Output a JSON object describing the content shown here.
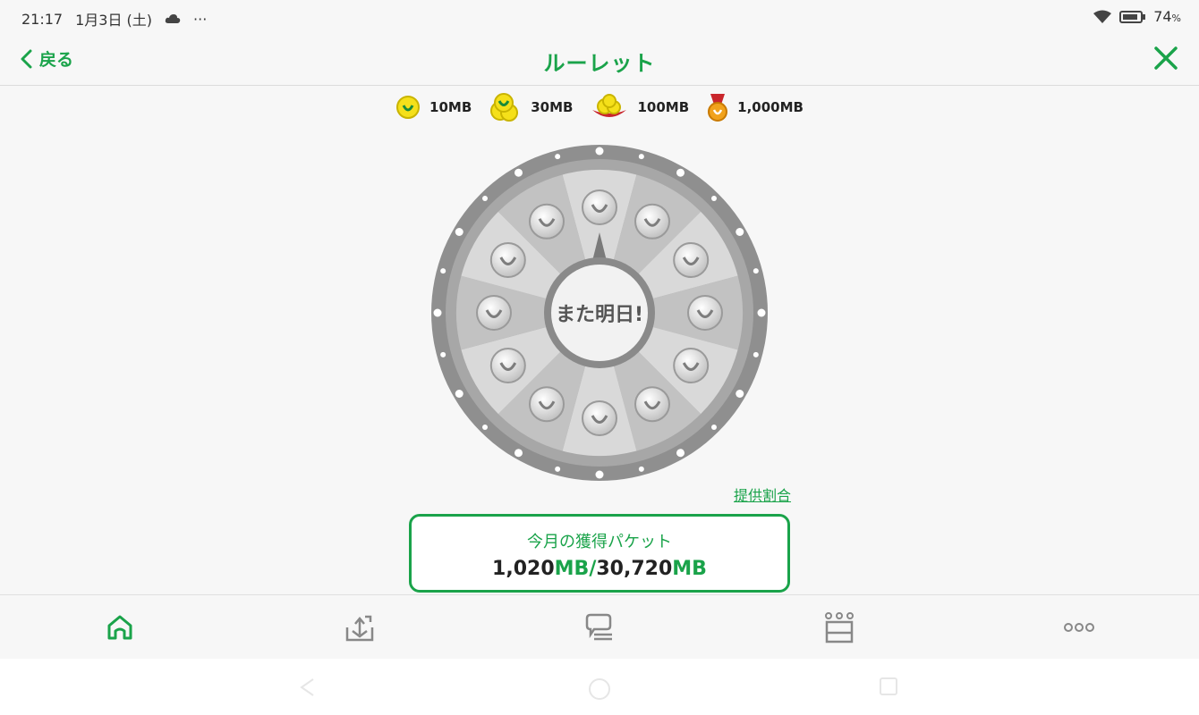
{
  "status": {
    "time": "21:17",
    "date": "1月3日 (土)",
    "more": "···",
    "battery": "74",
    "battery_unit": "%"
  },
  "header": {
    "back_label": "戻る",
    "title": "ルーレット"
  },
  "legend": [
    {
      "icon": "single-coin-icon",
      "label": "10MB"
    },
    {
      "icon": "coin-pile-icon",
      "label": "30MB"
    },
    {
      "icon": "coin-plate-icon",
      "label": "100MB"
    },
    {
      "icon": "gold-medal-icon",
      "label": "1,000MB"
    }
  ],
  "wheel": {
    "center_label": "また明日!"
  },
  "ratio_link": "提供割合",
  "packet": {
    "label": "今月の獲得パケット",
    "current": "1,020",
    "unit1": "MB",
    "slash": "/",
    "max": "30,720",
    "unit2": "MB"
  },
  "tabs": [
    "home-icon",
    "upload-tray-icon",
    "chat-icon",
    "ranking-crown-icon",
    "more-icon"
  ],
  "colors": {
    "accent": "#1aa34a",
    "wheel_dark": "#9a9a9a",
    "wheel_light": "#d9d9d9"
  }
}
